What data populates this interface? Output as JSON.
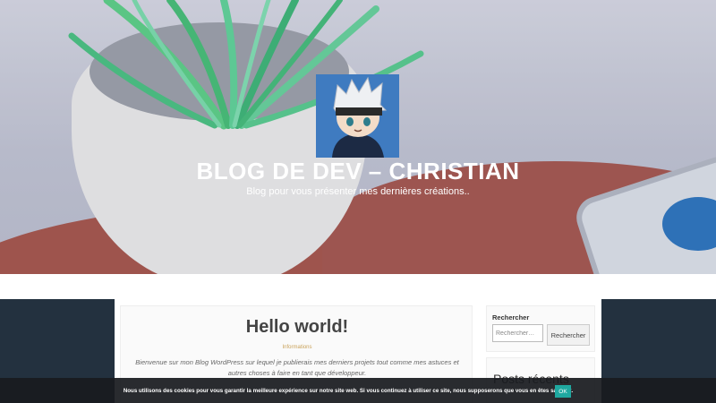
{
  "site": {
    "title": "BLOG DE DEV – CHRISTIAN",
    "description": "Blog pour vous présenter mes dernières créations.."
  },
  "post": {
    "title": "Hello world!",
    "category": "Informations",
    "excerpt": "Bienvenue sur mon Blog WordPress sur lequel je publierais mes derniers projets tout comme mes astuces et autres choses à faire en tant que développeur."
  },
  "sidebar": {
    "search": {
      "title": "Rechercher",
      "placeholder": "Rechercher…",
      "button_label": "Rechercher"
    },
    "recent_posts_title": "Posts récents"
  },
  "cookie_bar": {
    "text": "Nous utilisons des cookies pour vous garantir la meilleure expérience sur notre site web. Si vous continuez à utiliser ce site, nous supposerons que vous en êtes satisfait.",
    "ok_label": "OK"
  },
  "colors": {
    "page_bg": "#23313f",
    "accent": "#1fa8a0",
    "meta": "#c9a25a"
  }
}
